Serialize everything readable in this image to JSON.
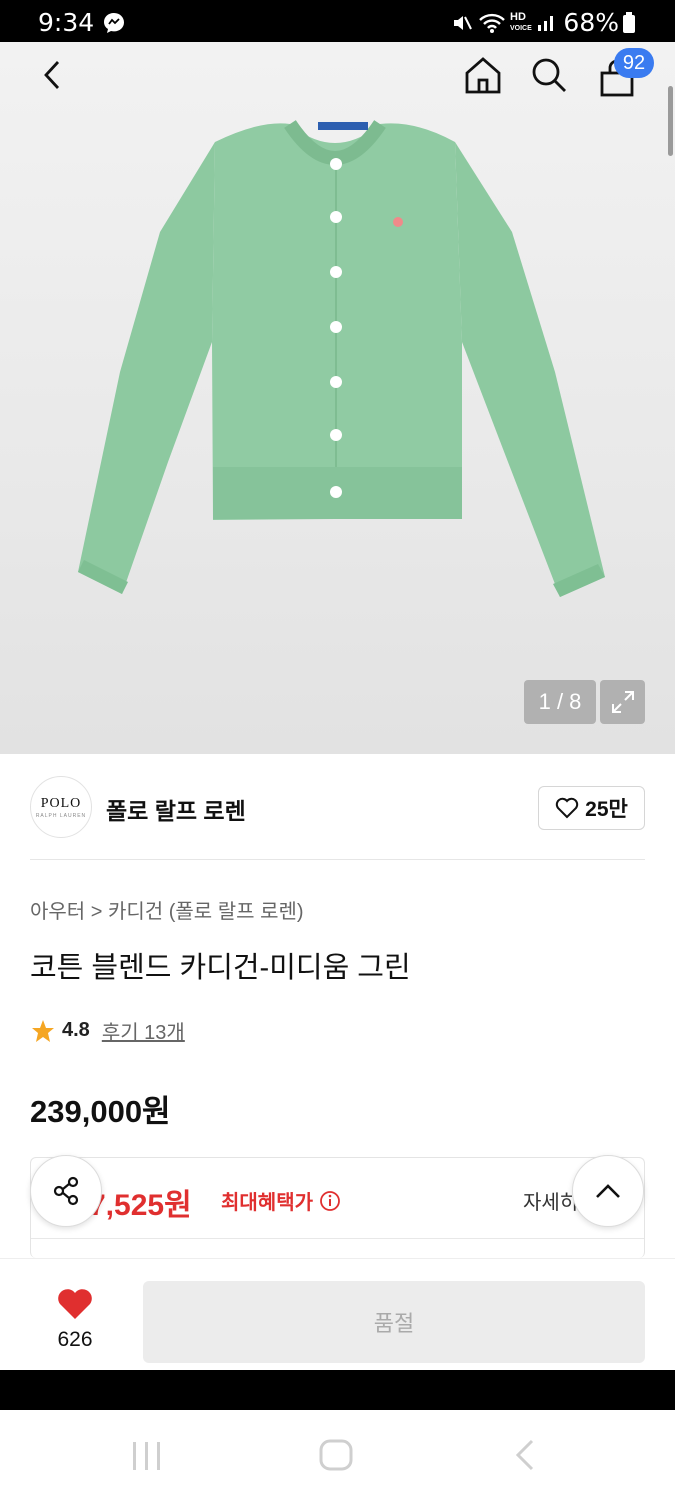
{
  "status_bar": {
    "time": "9:34",
    "battery": "68%"
  },
  "header": {
    "cart_count": "92"
  },
  "gallery": {
    "counter": "1 / 8"
  },
  "brand": {
    "logo_text": "POLO",
    "logo_subtext": "RALPH LAUREN",
    "name": "폴로 랄프 로렌",
    "likes": "25만"
  },
  "product": {
    "breadcrumb": "아우터 > 카디건 (폴로 랄프 로렌)",
    "title": "코튼 블렌드 카디건-미디움 그린",
    "rating": "4.8",
    "reviews": "후기 13개",
    "price": "239,000원"
  },
  "benefit": {
    "price": "7,525원",
    "label": "최대혜택가",
    "detail": "자세히"
  },
  "bottom": {
    "wish_count": "626",
    "buy_label": "품절"
  },
  "colors": {
    "accent_red": "#e02f2f",
    "badge_blue": "#3a7bf0",
    "star": "#f5a623",
    "cardigan_green": "#8dc9a0"
  }
}
